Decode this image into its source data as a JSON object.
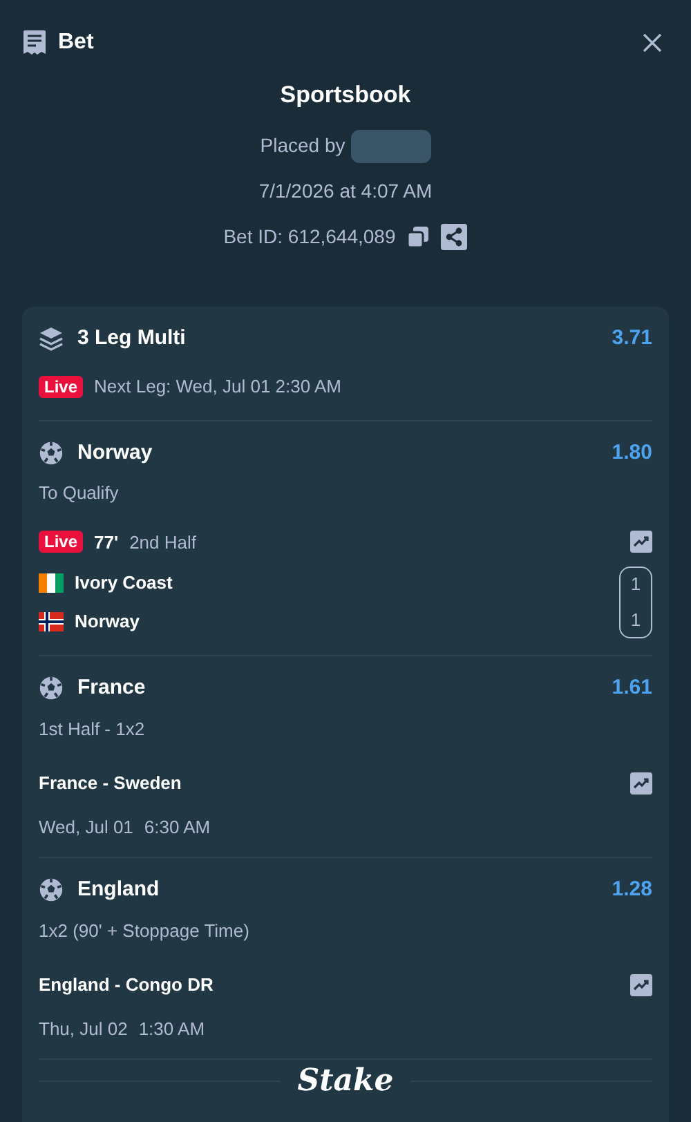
{
  "header": {
    "title": "Bet"
  },
  "summary": {
    "title": "Sportsbook",
    "placed_by": "Placed by",
    "date": "7/1/2026 at 4:07 AM",
    "bet_id": "Bet ID: 612,644,089"
  },
  "multi": {
    "title": "3 Leg Multi",
    "odds": "3.71",
    "badge": "Live",
    "next_leg": "Next Leg: Wed, Jul 01 2:30 AM"
  },
  "legs": [
    {
      "kind": "live",
      "selection": "Norway",
      "odds": "1.80",
      "market": "To Qualify",
      "badge": "Live",
      "minute": "77'",
      "period": "2nd Half",
      "teams": [
        {
          "name": "Ivory Coast",
          "kind": "civ",
          "score": "1"
        },
        {
          "name": "Norway",
          "kind": "nor",
          "score": "1"
        }
      ]
    },
    {
      "kind": "scheduled",
      "selection": "France",
      "odds": "1.61",
      "market": "1st Half - 1x2",
      "match": "France - Sweden",
      "date": "Wed, Jul 01",
      "time": "6:30 AM"
    },
    {
      "kind": "scheduled",
      "selection": "England",
      "odds": "1.28",
      "market": "1x2 (90' + Stoppage Time)",
      "match": "England - Congo DR",
      "date": "Thu, Jul 02",
      "time": "1:30 AM"
    }
  ],
  "footer": {
    "logo": "Stake"
  }
}
